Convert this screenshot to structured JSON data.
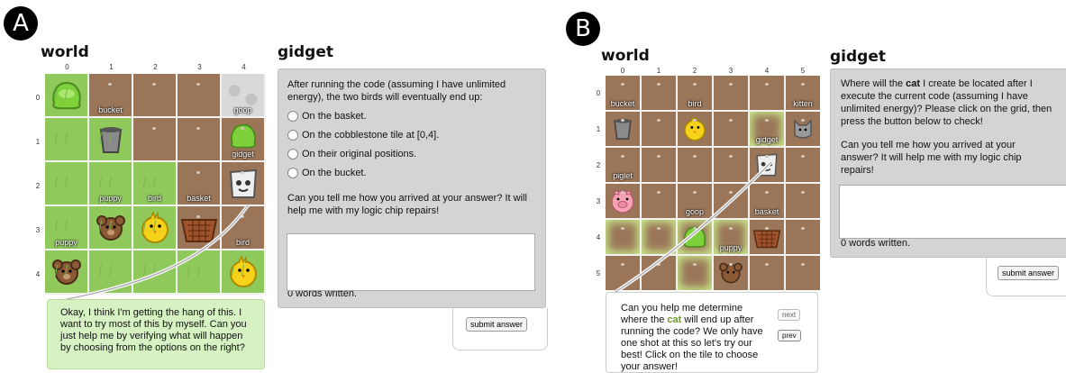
{
  "panel_a": {
    "badge": "A",
    "world_title": "world",
    "gidget_title": "gidget",
    "col_numbers": [
      "0",
      "1",
      "2",
      "3",
      "4"
    ],
    "row_numbers": [
      "0",
      "1",
      "2",
      "3",
      "4"
    ],
    "tiles": {
      "bucket": "bucket",
      "goop": "goop",
      "gidget": "gidget",
      "puppy": "puppy",
      "bird": "bird",
      "basket": "basket",
      "puppy2": "puppy",
      "bird2": "bird"
    },
    "question": "After running the code (assuming I have unlimited energy), the two birds will eventually end up:",
    "options": [
      "On the basket.",
      "On the cobblestone tile at [0,4].",
      "On their original positions.",
      "On the bucket."
    ],
    "prompt": "Can you tell me how you arrived at your answer? It will help me with my logic chip repairs!",
    "words": "0 words written.",
    "submit": "submit answer",
    "speech": "Okay, I think I'm getting the hang of this. I want to try most of this by myself. Can you just help me by verifying what will happen by choosing from the options on the right?"
  },
  "panel_b": {
    "badge": "B",
    "world_title": "world",
    "gidget_title": "gidget",
    "col_numbers": [
      "0",
      "1",
      "2",
      "3",
      "4",
      "5"
    ],
    "row_numbers": [
      "0",
      "1",
      "2",
      "3",
      "4",
      "5"
    ],
    "tiles": {
      "bucket": "bucket",
      "bird": "bird",
      "kitten": "kitten",
      "gidget": "gidget",
      "piglet": "piglet",
      "goop": "goop",
      "basket": "basket",
      "puppy": "puppy"
    },
    "question_pre": "Where will the ",
    "question_bold": "cat",
    "question_post": " I create be located after I execute the current code (assuming I have unlimited energy)? Please click on the grid, then press the button below to check!",
    "prompt": "Can you tell me how you arrived at your answer? It will help me with my logic chip repairs!",
    "words": "0 words written.",
    "submit": "submit answer",
    "speech_pre": "Can you help me determine where the ",
    "speech_bold": "cat",
    "speech_post": " will end up after running the code? We only have one shot at this so let's try our best! Click on the tile to choose your answer!",
    "next": "next",
    "prev": "prev"
  },
  "colors": {
    "dirt": "#9a7558",
    "grass": "#8fc95c",
    "speech_green": "#d6f1c2",
    "panel_gray": "#d4d4d4",
    "cat_highlight": "#6a9a2a"
  }
}
